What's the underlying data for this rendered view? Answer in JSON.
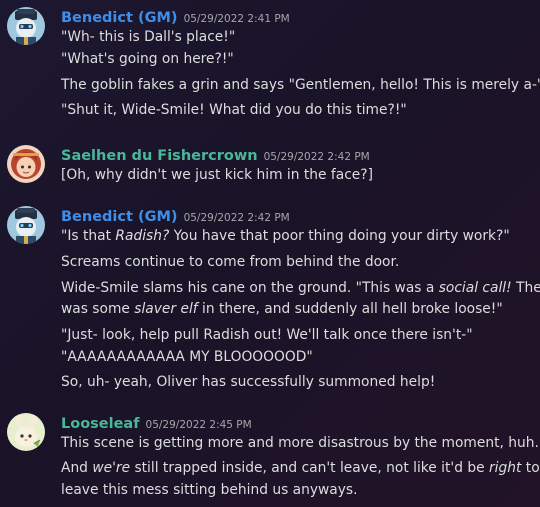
{
  "messages": [
    {
      "author": "Benedict (GM)",
      "author_color": "#3f8ee8",
      "timestamp": "05/29/2022 2:41 PM",
      "avatar_icon": "robot-knight-avatar",
      "lines": [
        "\"Wh- this is Dall's place!\"",
        "\"What's going on here?!\"",
        "The goblin fakes a grin and says \"Gentlemen, hello! This is merely a-\"",
        "\"Shut it, Wide-Smile! What did you do this time?!\""
      ]
    },
    {
      "author": "Saelhen du Fishercrown",
      "author_color": "#49b79a",
      "timestamp": "05/29/2022 2:42 PM",
      "avatar_icon": "redhead-girl-avatar",
      "lines": [
        "[Oh, why didn't we just kick him in the face?]"
      ]
    },
    {
      "author": "Benedict (GM)",
      "author_color": "#3f8ee8",
      "timestamp": "05/29/2022 2:42 PM",
      "avatar_icon": "robot-knight-avatar",
      "lines": [
        {
          "pre": "\"Is that ",
          "em": "Radish?",
          "post": " You have that poor thing doing your dirty work?\""
        },
        "Screams continue to come from behind the door.",
        {
          "pre": "Wide-Smile slams his cane on the ground. \"This was a ",
          "em": "social call!",
          "post": " There"
        },
        {
          "pre": "was some ",
          "em": "slaver elf",
          "post": " in there, and suddenly all hell broke loose!\""
        },
        "\"Just- look, help pull Radish out! We'll talk once there isn't-\"",
        "\"AAAAAAAAAAAA MY BLOOOOOOD\"",
        "So, uh- yeah, Oliver has successfully summoned help!"
      ]
    },
    {
      "author": "Looseleaf",
      "author_color": "#49b79a",
      "timestamp": "05/29/2022 2:45 PM",
      "avatar_icon": "rabbit-avatar",
      "lines": [
        "This scene is getting more and more disastrous by the moment, huh.",
        {
          "pre": "And ",
          "em": "we're",
          "post": " still trapped inside, and can't leave, not like it'd be ",
          "em2": "right",
          "post2": " to"
        },
        "leave this mess sitting behind us anyways."
      ]
    }
  ]
}
